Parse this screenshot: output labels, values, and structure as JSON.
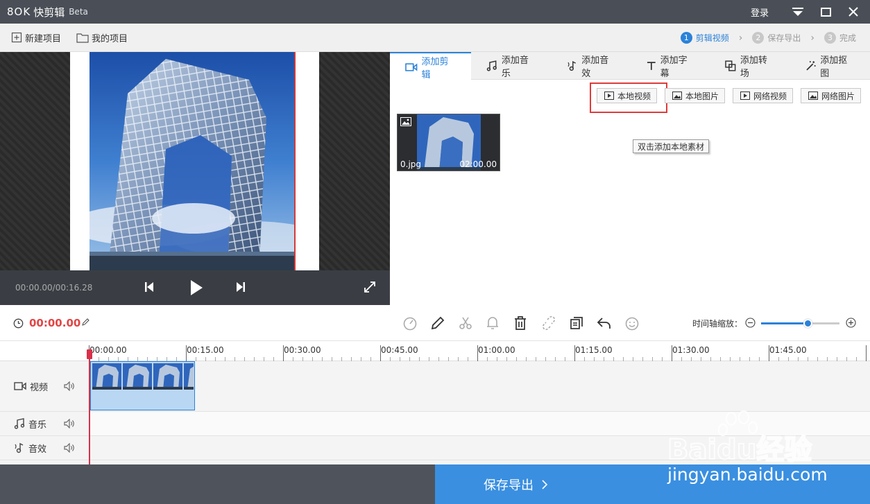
{
  "app": {
    "logo": "8OK",
    "name": "快剪辑",
    "beta": "Beta",
    "login": "登录"
  },
  "toolbar": {
    "new_project": "新建项目",
    "my_projects": "我的项目"
  },
  "steps": [
    {
      "num": "1",
      "label": "剪辑视频",
      "active": true
    },
    {
      "num": "2",
      "label": "保存导出",
      "active": false
    },
    {
      "num": "3",
      "label": "完成",
      "active": false
    }
  ],
  "player": {
    "time": "00:00.00/00:16.28"
  },
  "tabs": [
    {
      "label": "添加剪辑",
      "icon": "video-camera-icon",
      "active": true
    },
    {
      "label": "添加音乐",
      "icon": "music-note-icon"
    },
    {
      "label": "添加音效",
      "icon": "sound-effect-icon"
    },
    {
      "label": "添加字幕",
      "icon": "text-icon"
    },
    {
      "label": "添加转场",
      "icon": "transition-icon"
    },
    {
      "label": "添加抠图",
      "icon": "magic-wand-icon"
    }
  ],
  "sources": {
    "local_video": "本地视频",
    "local_image": "本地图片",
    "web_video": "网络视频",
    "web_image": "网络图片"
  },
  "media": {
    "name": "0.jpg",
    "duration": "02:00.00"
  },
  "tooltip": "双击添加本地素材",
  "edit": {
    "current_time": "00:00.00",
    "zoom_label": "时间轴缩放：",
    "zoom_level": 0.6
  },
  "timeline": {
    "ticks": [
      "00:00.00",
      "00:15.00",
      "00:30.00",
      "00:45.00",
      "01:00.00",
      "01:15.00",
      "01:30.00",
      "01:45.00"
    ],
    "tracks": {
      "video": "视频",
      "music": "音乐",
      "sfx": "音效"
    }
  },
  "bottom": {
    "save_export": "保存导出"
  },
  "watermark": {
    "brand": "Baidu经验",
    "url": "jingyan.baidu.com"
  },
  "colors": {
    "accent": "#2b82d9",
    "time_red": "#e04646",
    "highlight_red": "#e03a3a"
  }
}
